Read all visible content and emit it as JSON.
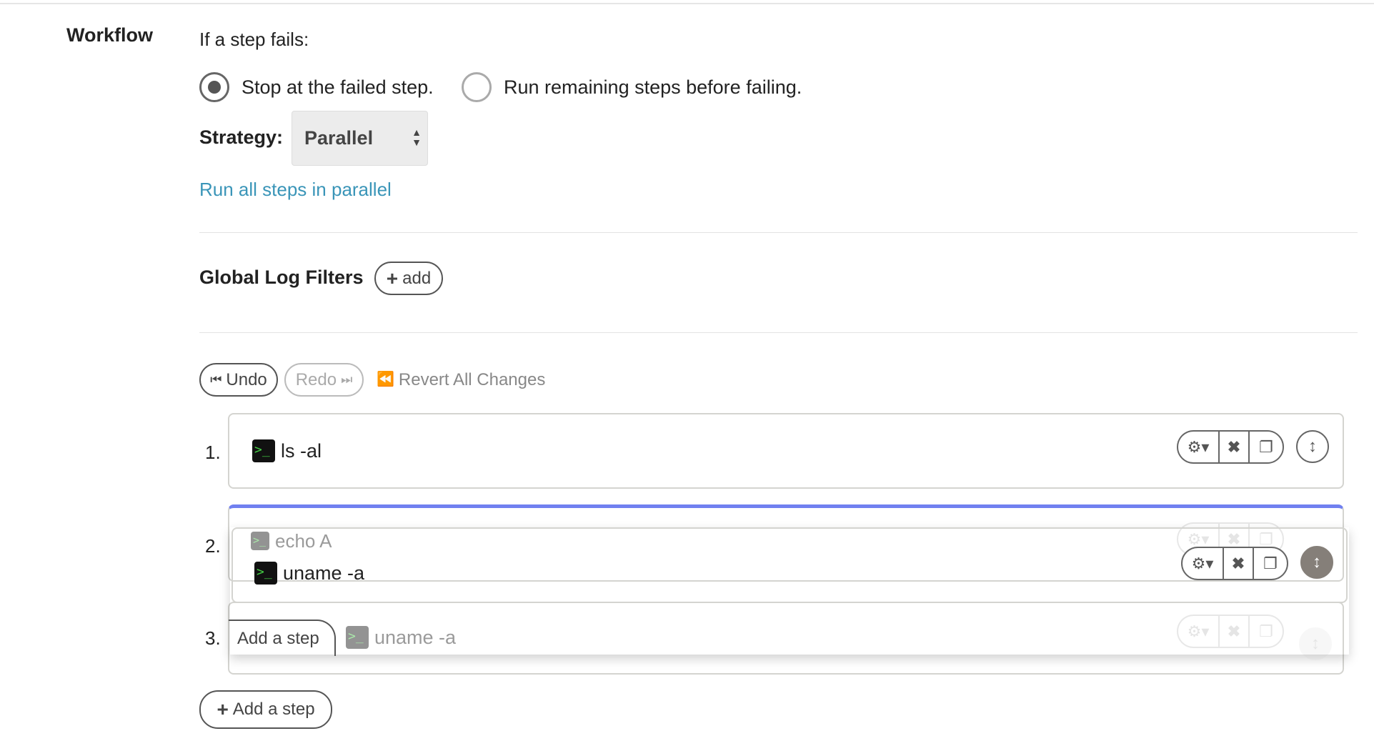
{
  "section_title": "Workflow",
  "failure": {
    "label": "If a step fails:",
    "options": [
      {
        "label": "Stop at the failed step.",
        "selected": true
      },
      {
        "label": "Run remaining steps before failing.",
        "selected": false
      }
    ]
  },
  "strategy": {
    "label": "Strategy:",
    "value": "Parallel",
    "description": "Run all steps in parallel"
  },
  "log_filters": {
    "title": "Global Log Filters",
    "add_label": "add"
  },
  "history": {
    "undo": "Undo",
    "redo": "Redo",
    "revert": "Revert All Changes"
  },
  "steps": [
    {
      "number": "1.",
      "command": "ls -al"
    },
    {
      "number": "2.",
      "command": "echo A"
    },
    {
      "number": "3.",
      "command": "uname -a"
    }
  ],
  "dragging": {
    "command": "uname -a",
    "placeholder_button": "Add a step"
  },
  "add_step_label": "Add a step",
  "colors": {
    "link": "#3a95b8",
    "drop_indicator": "#7080f0",
    "terminal_green": "#44cc44"
  }
}
